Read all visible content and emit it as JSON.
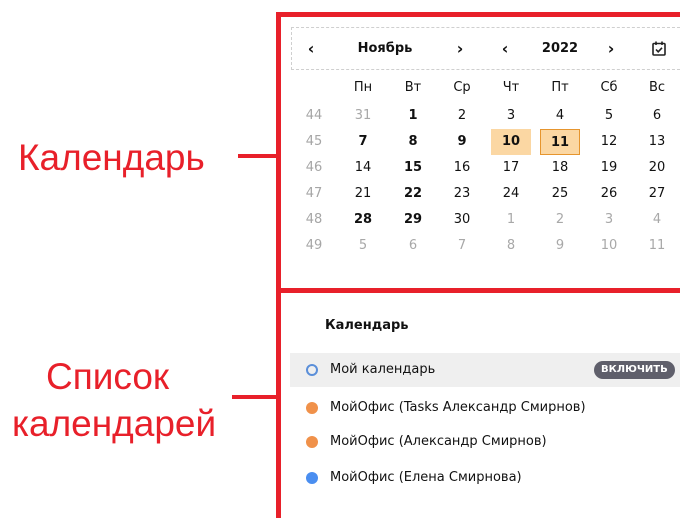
{
  "annotations": {
    "calendar_label": "Календарь",
    "list_label_line1": "Список",
    "list_label_line2": "календарей",
    "color": "#e8202a"
  },
  "calendar": {
    "month": "Ноябрь",
    "year": "2022",
    "prev_month_icon": "chevron-left-icon",
    "next_month_icon": "chevron-right-icon",
    "prev_year_icon": "chevron-left-icon",
    "next_year_icon": "chevron-right-icon",
    "today_icon": "calendar-check-icon",
    "weekdays": [
      "Пн",
      "Вт",
      "Ср",
      "Чт",
      "Пт",
      "Сб",
      "Вс"
    ],
    "weeks": [
      {
        "number": "44",
        "days": [
          {
            "d": "31",
            "s": "o"
          },
          {
            "d": "1",
            "s": "b"
          },
          {
            "d": "2"
          },
          {
            "d": "3"
          },
          {
            "d": "4"
          },
          {
            "d": "5"
          },
          {
            "d": "6"
          }
        ]
      },
      {
        "number": "45",
        "days": [
          {
            "d": "7",
            "s": "b"
          },
          {
            "d": "8",
            "s": "b"
          },
          {
            "d": "9",
            "s": "b"
          },
          {
            "d": "10",
            "s": "sel"
          },
          {
            "d": "11",
            "s": "today"
          },
          {
            "d": "12"
          },
          {
            "d": "13"
          }
        ]
      },
      {
        "number": "46",
        "days": [
          {
            "d": "14"
          },
          {
            "d": "15",
            "s": "b"
          },
          {
            "d": "16"
          },
          {
            "d": "17"
          },
          {
            "d": "18"
          },
          {
            "d": "19"
          },
          {
            "d": "20"
          }
        ]
      },
      {
        "number": "47",
        "days": [
          {
            "d": "21"
          },
          {
            "d": "22",
            "s": "b"
          },
          {
            "d": "23"
          },
          {
            "d": "24"
          },
          {
            "d": "25"
          },
          {
            "d": "26"
          },
          {
            "d": "27"
          }
        ]
      },
      {
        "number": "48",
        "days": [
          {
            "d": "28",
            "s": "b"
          },
          {
            "d": "29",
            "s": "b"
          },
          {
            "d": "30"
          },
          {
            "d": "1",
            "s": "o"
          },
          {
            "d": "2",
            "s": "o"
          },
          {
            "d": "3",
            "s": "o"
          },
          {
            "d": "4",
            "s": "o"
          }
        ]
      },
      {
        "number": "49",
        "days": [
          {
            "d": "5",
            "s": "o"
          },
          {
            "d": "6",
            "s": "o"
          },
          {
            "d": "7",
            "s": "o"
          },
          {
            "d": "8",
            "s": "o"
          },
          {
            "d": "9",
            "s": "o"
          },
          {
            "d": "10",
            "s": "o"
          },
          {
            "d": "11",
            "s": "o"
          }
        ]
      }
    ],
    "selected_color": "#fbd7a3",
    "today_border_color": "#e6952e"
  },
  "calendars_list": {
    "title": "Календарь",
    "items": [
      {
        "label": "Мой календарь",
        "color": "#5b8fd9",
        "hollow": true,
        "highlighted": true,
        "button": "ВКЛЮЧИТЬ"
      },
      {
        "label": "МойОфис (Tasks Александр Смирнов)",
        "color": "#f0914a"
      },
      {
        "label": "МойОфис (Александр Смирнов)",
        "color": "#f0914a"
      },
      {
        "label": "МойОфис (Елена Смирнова)",
        "color": "#4a8ef0"
      }
    ]
  }
}
